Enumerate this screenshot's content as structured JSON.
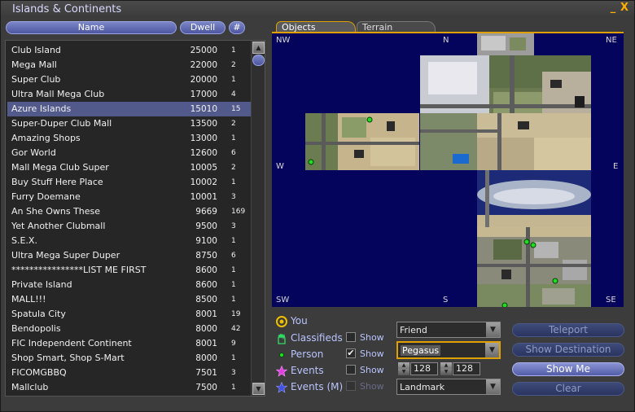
{
  "window": {
    "title": "Islands & Continents",
    "minimize_glyph": "_",
    "close_glyph": "X"
  },
  "list": {
    "headers": {
      "name": "Name",
      "dwell": "Dwell",
      "count": "#"
    },
    "rows": [
      {
        "name": "Club Island",
        "dwell": "25000",
        "count": "1"
      },
      {
        "name": "Mega Mall",
        "dwell": "22000",
        "count": "2"
      },
      {
        "name": "Super Club",
        "dwell": "20000",
        "count": "1"
      },
      {
        "name": "Ultra Mall Mega Club",
        "dwell": "17000",
        "count": "4"
      },
      {
        "name": "Azure Islands",
        "dwell": "15010",
        "count": "15"
      },
      {
        "name": "Super-Duper Club Mall",
        "dwell": "13500",
        "count": "2"
      },
      {
        "name": "Amazing Shops",
        "dwell": "13000",
        "count": "1"
      },
      {
        "name": "Gor World",
        "dwell": "12600",
        "count": "6"
      },
      {
        "name": "Mall Mega Club Super",
        "dwell": "10005",
        "count": "2"
      },
      {
        "name": "Buy Stuff Here Place",
        "dwell": "10002",
        "count": "1"
      },
      {
        "name": "Furry Doemane",
        "dwell": "10001",
        "count": "3"
      },
      {
        "name": "An She Owns These",
        "dwell": "9669",
        "count": "169"
      },
      {
        "name": "Yet Another Clubmall",
        "dwell": "9500",
        "count": "3"
      },
      {
        "name": "S.E.X.",
        "dwell": "9100",
        "count": "1"
      },
      {
        "name": "Ultra Mega Super Duper",
        "dwell": "8750",
        "count": "6"
      },
      {
        "name": "****************LIST ME FIRST",
        "dwell": "8600",
        "count": "1"
      },
      {
        "name": "Private Island",
        "dwell": "8600",
        "count": "1"
      },
      {
        "name": "MALL!!!",
        "dwell": "8500",
        "count": "1"
      },
      {
        "name": "Spatula City",
        "dwell": "8001",
        "count": "19"
      },
      {
        "name": "Bendopolis",
        "dwell": "8000",
        "count": "42"
      },
      {
        "name": "FIC Independent Continent",
        "dwell": "8001",
        "count": "9"
      },
      {
        "name": "Shop Smart, Shop S-Mart",
        "dwell": "8000",
        "count": "1"
      },
      {
        "name": "FICOMGBBQ",
        "dwell": "7501",
        "count": "3"
      },
      {
        "name": "Mallclub",
        "dwell": "7500",
        "count": "1"
      }
    ],
    "selected_index": 4
  },
  "tabs": [
    {
      "label": "Objects",
      "active": true
    },
    {
      "label": "Terrain",
      "active": false
    }
  ],
  "map": {
    "compass": {
      "nw": "NW",
      "n": "N",
      "ne": "NE",
      "w": "W",
      "e": "E",
      "sw": "SW",
      "s": "S",
      "se": "SE"
    }
  },
  "legend": {
    "you": "You",
    "classifieds": "Classifieds",
    "person": "Person",
    "events": "Events",
    "events_m": "Events (M)",
    "show": "Show",
    "show_classifieds": false,
    "show_person": true,
    "show_events": false,
    "show_events_m": false
  },
  "controls": {
    "friend_combo": "Friend",
    "avatar_combo": "Pegasus",
    "coord_x": "128",
    "coord_y": "128",
    "landmark_combo": "Landmark"
  },
  "buttons": {
    "teleport": "Teleport",
    "show_destination": "Show Destination",
    "show_me": "Show Me",
    "clear": "Clear"
  },
  "colors": {
    "accent": "#e0a000",
    "water": "#05045c",
    "button": "#535da8",
    "selection": "#525a8c"
  }
}
